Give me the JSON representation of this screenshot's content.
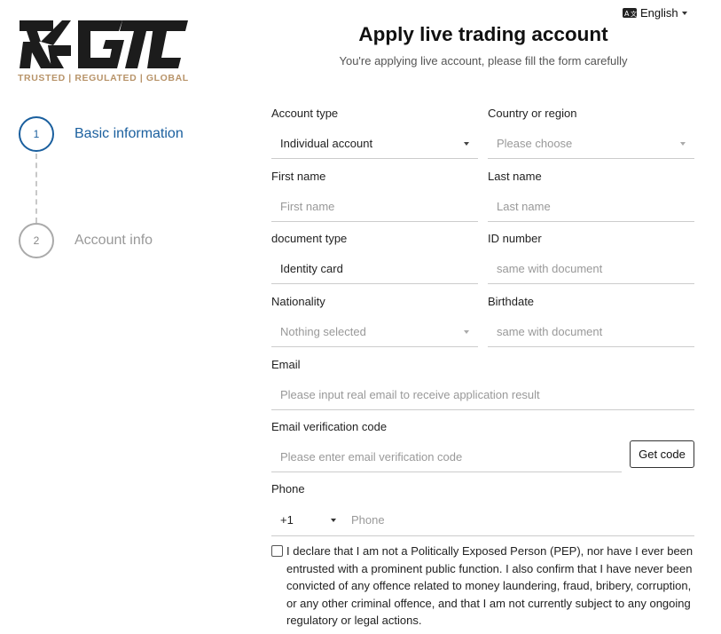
{
  "language": {
    "icon": "translate-icon",
    "label": "English"
  },
  "brand": {
    "logo_text": "GTC",
    "tagline": "TRUSTED | REGULATED | GLOBAL"
  },
  "header": {
    "title": "Apply live trading account",
    "subtitle": "You're applying live account, please fill the form carefully"
  },
  "steps": [
    {
      "number": "1",
      "label": "Basic information",
      "state": "active"
    },
    {
      "number": "2",
      "label": "Account info",
      "state": "inactive"
    }
  ],
  "form": {
    "account_type": {
      "label": "Account type",
      "value": "Individual account"
    },
    "country": {
      "label": "Country or region",
      "placeholder": "Please choose"
    },
    "first_name": {
      "label": "First name",
      "placeholder": "First name"
    },
    "last_name": {
      "label": "Last name",
      "placeholder": "Last name"
    },
    "document_type": {
      "label": "document type",
      "value": "Identity card"
    },
    "id_number": {
      "label": "ID number",
      "placeholder": "same with document"
    },
    "nationality": {
      "label": "Nationality",
      "placeholder": "Nothing selected"
    },
    "birthdate": {
      "label": "Birthdate",
      "placeholder": "same with document"
    },
    "email": {
      "label": "Email",
      "placeholder": "Please input real email to receive application result"
    },
    "email_code": {
      "label": "Email verification code",
      "placeholder": "Please enter email verification code",
      "button": "Get code"
    },
    "phone": {
      "label": "Phone",
      "country_code": "+1",
      "placeholder": "Phone"
    },
    "declaration": {
      "checked": false,
      "text": "I declare that I am not a Politically Exposed Person (PEP), nor have I ever been entrusted with a prominent public function. I also confirm that I have never been convicted of any offence related to money laundering, fraud, bribery, corruption, or any other criminal offence, and that I am not currently subject to any ongoing regulatory or legal actions."
    }
  },
  "colors": {
    "accent": "#1a5f9e",
    "tagline": "#b8946a",
    "logo": "#1c1c1c"
  }
}
